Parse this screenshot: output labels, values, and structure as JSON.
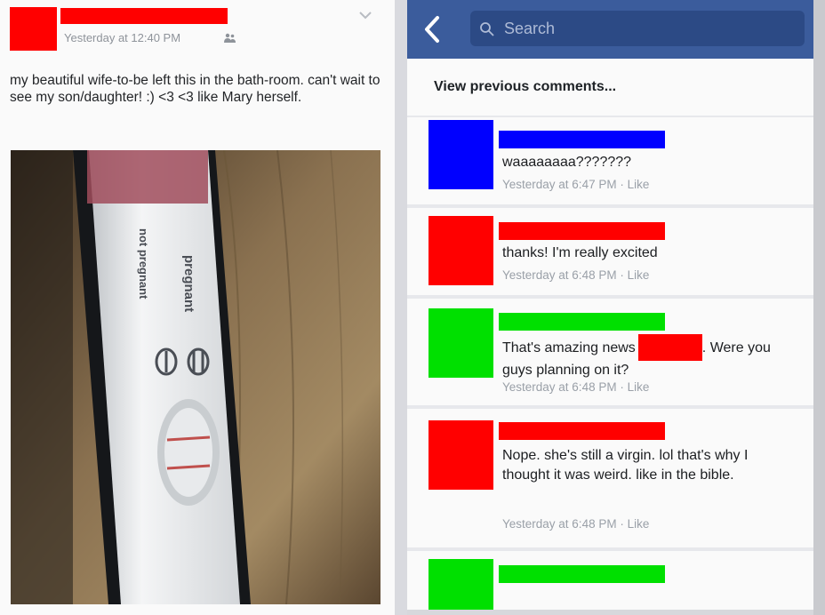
{
  "post": {
    "timestamp": "Yesterday at 12:40 PM",
    "text": "my beautiful wife-to-be left this in the bath-room. can't wait to see my son/daughter! :) <3 <3 like Mary herself.",
    "photo_labels": {
      "pregnant": "pregnant",
      "not_pregnant": "not pregnant"
    }
  },
  "comments_view": {
    "search_placeholder": "Search",
    "view_previous": "View previous comments...",
    "comments": [
      {
        "avatar_color": "#0000ff",
        "text": "waaaaaaaa???????",
        "time": "Yesterday at 6:47 PM",
        "like": "Like"
      },
      {
        "avatar_color": "#ff0000",
        "text": "thanks! I'm really excited",
        "time": "Yesterday at 6:48 PM",
        "like": "Like"
      },
      {
        "avatar_color": "#00e000",
        "text_before": "That's amazing news",
        "text_after": ". Were you guys planning on it?",
        "time": "Yesterday at 6:48 PM",
        "like": "Like"
      },
      {
        "avatar_color": "#ff0000",
        "text": "Nope. she's still a virgin. lol that's why I thought it was weird. like in the bible.",
        "time": "Yesterday at 6:48 PM",
        "like": "Like"
      },
      {
        "avatar_color": "#00e000"
      }
    ],
    "separator": " · "
  },
  "colors": {
    "redaction_red": "#ff0000",
    "redaction_blue": "#0000ff",
    "redaction_green": "#00e000",
    "facebook_blue": "#3b5c9c"
  },
  "icons": [
    "audience-icon",
    "chevron-down-icon",
    "back-chevron-icon",
    "search-icon"
  ]
}
